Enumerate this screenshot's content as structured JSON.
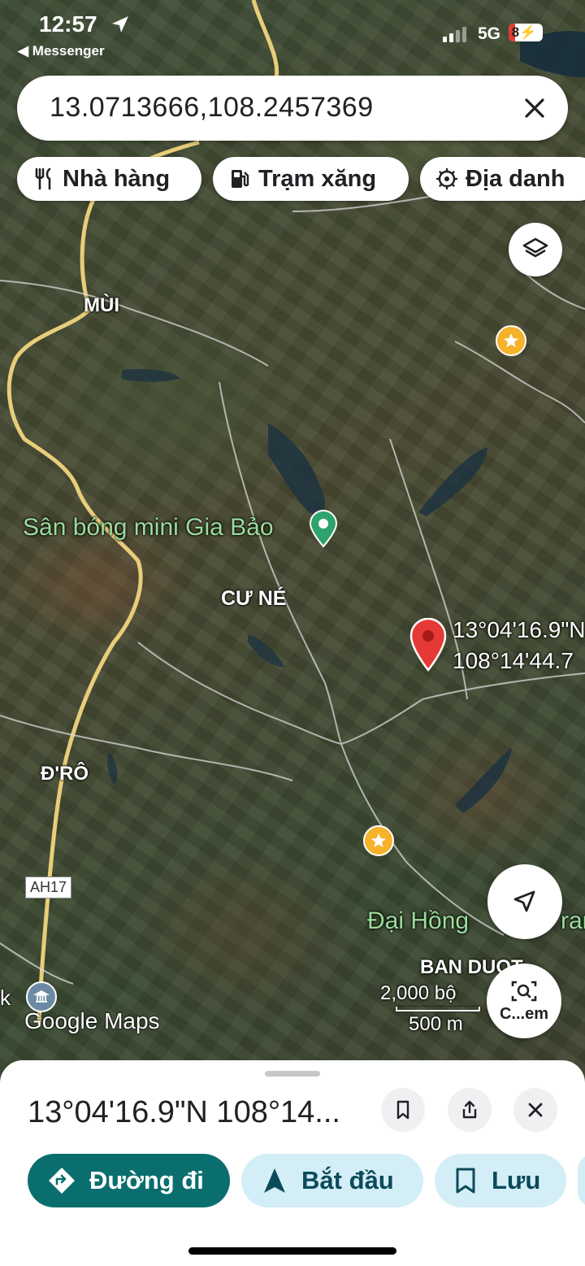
{
  "status_bar": {
    "time": "12:57",
    "back_app": "◀ Messenger",
    "network": "5G",
    "battery": "8",
    "battery_level": 0.08
  },
  "search": {
    "query": "13.0713666,108.2457369"
  },
  "chips": [
    {
      "label": "Nhà hàng",
      "icon": "restaurant-icon"
    },
    {
      "label": "Trạm xăng",
      "icon": "gas-station-icon"
    },
    {
      "label": "Địa danh",
      "icon": "landmark-icon"
    }
  ],
  "map": {
    "places": [
      "MÙI",
      "CƯ NÉ",
      "Đ'RÔ",
      "BAN DUOT"
    ],
    "poi_sports": "Sân bóng mini Gia Bảo",
    "poi_partial": "Đại Hồng",
    "poi_partial_tail": "ran",
    "road_shield": "AH17",
    "pin_lat": "13°04'16.9\"N",
    "pin_lng": "108°14'44.7",
    "edge_label": "k",
    "scale_imperial": "2,000 bộ",
    "scale_metric": "500 m",
    "attribution": "Google Maps",
    "search_this_area": "C...em"
  },
  "sheet": {
    "title": "13°04'16.9\"N 108°14...",
    "directions": "Đường đi",
    "start": "Bắt đầu",
    "save": "Lưu"
  },
  "colors": {
    "accent_teal": "#0b6e6e",
    "pill_light": "#d3eef6",
    "pin_red": "#e53935",
    "poi_green": "#2ea36b"
  }
}
